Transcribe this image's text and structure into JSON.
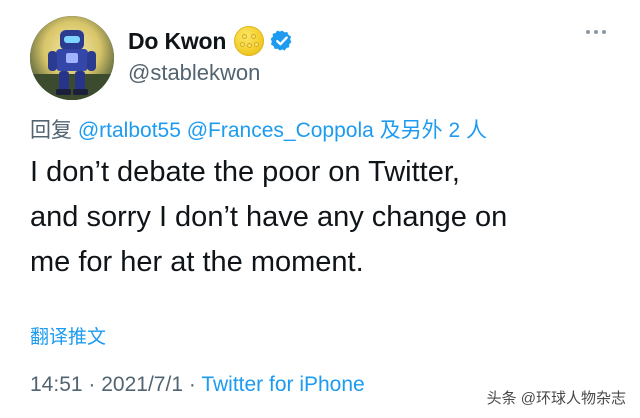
{
  "author": {
    "display_name": "Do Kwon",
    "name_emoji": "yellow-coin-emoji",
    "verified_icon": "verified-badge-icon",
    "handle": "@stablekwon",
    "avatar_icon": "robot-avatar"
  },
  "reply": {
    "prefix": "回复",
    "mention_1": "@rtalbot55",
    "mention_2": "@Frances_Coppola",
    "suffix": "及另外 2 人"
  },
  "tweet": {
    "lines": [
      "I don’t debate the poor on Twitter,",
      "and sorry I don’t have any change on",
      "me for her at the moment."
    ]
  },
  "translate_label": "翻译推文",
  "meta": {
    "time": "14:51",
    "separator_1": "·",
    "date": "2021/7/1",
    "separator_2": "·",
    "source": "Twitter for iPhone"
  },
  "watermark": "头条 @环球人物杂志",
  "colors": {
    "link": "#1d9bf0",
    "secondary_text": "#536471",
    "verified": "#1d9bf0"
  }
}
